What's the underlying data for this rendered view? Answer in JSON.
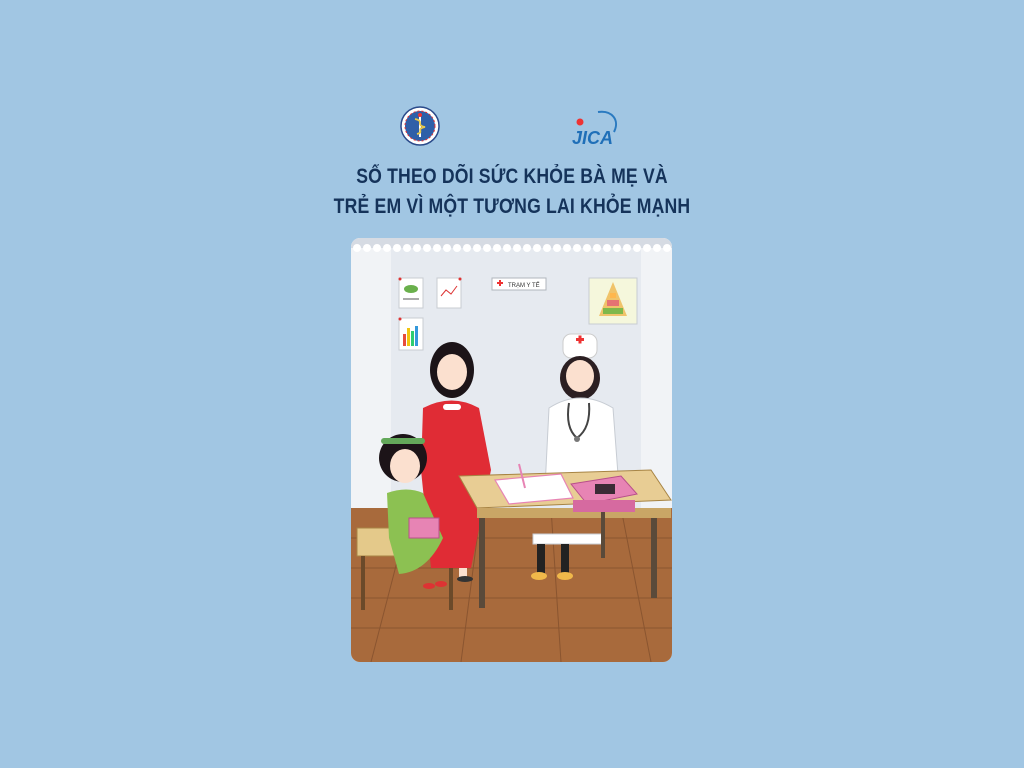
{
  "cover": {
    "logos": {
      "ministry_logo_icon": "ministry-of-health-emblem",
      "jica_logo_text": "JICA"
    },
    "title_line_1": "SỔ THEO DÕI SỨC KHỎE BÀ MẸ VÀ",
    "title_line_2": "TRẺ EM VÌ MỘT TƯƠNG LAI KHỎE MẠNH"
  },
  "illustration": {
    "wall_sign": "TRẠM Y TẾ"
  },
  "colors": {
    "background": "#a1c6e3",
    "title": "#15335a",
    "mother_dress": "#e02c35",
    "child_dress": "#8cc152",
    "booklet": "#e784b4",
    "floor": "#a86a3c"
  }
}
